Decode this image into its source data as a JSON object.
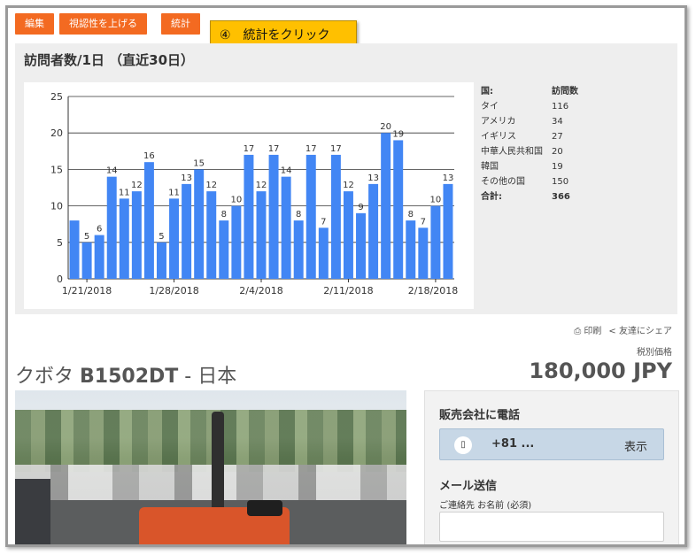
{
  "toolbar": {
    "buttons": [
      {
        "label": "編集"
      },
      {
        "label": "視認性を上げる"
      },
      {
        "label": "統計"
      }
    ]
  },
  "callout": {
    "text": "④　統計をクリック"
  },
  "stats": {
    "title": "訪問者数/1日 （直近30日）",
    "table": {
      "header": {
        "country": "国:",
        "visits": "訪問数"
      },
      "rows": [
        {
          "country": "タイ",
          "visits": "116"
        },
        {
          "country": "アメリカ",
          "visits": "34"
        },
        {
          "country": "イギリス",
          "visits": "27"
        },
        {
          "country": "中華人民共和国",
          "visits": "20"
        },
        {
          "country": "韓国",
          "visits": "19"
        },
        {
          "country": "その他の国",
          "visits": "150"
        }
      ],
      "total": {
        "label": "合計:",
        "value": "366"
      }
    }
  },
  "chart_data": {
    "type": "bar",
    "categories": [
      "1/20/2018",
      "1/21/2018",
      "1/22/2018",
      "1/23/2018",
      "1/24/2018",
      "1/25/2018",
      "1/26/2018",
      "1/27/2018",
      "1/28/2018",
      "1/29/2018",
      "1/30/2018",
      "1/31/2018",
      "2/1/2018",
      "2/2/2018",
      "2/3/2018",
      "2/4/2018",
      "2/5/2018",
      "2/6/2018",
      "2/7/2018",
      "2/8/2018",
      "2/9/2018",
      "2/10/2018",
      "2/11/2018",
      "2/12/2018",
      "2/13/2018",
      "2/14/2018",
      "2/15/2018",
      "2/16/2018",
      "2/17/2018",
      "2/18/2018"
    ],
    "values": [
      8,
      5,
      6,
      14,
      11,
      12,
      16,
      5,
      11,
      13,
      15,
      12,
      8,
      10,
      17,
      12,
      17,
      14,
      8,
      17,
      7,
      17,
      12,
      9,
      13,
      20,
      19,
      8,
      7,
      10,
      13
    ],
    "labeled": [
      false,
      true,
      true,
      true,
      true,
      true,
      true,
      true,
      true,
      true,
      true,
      true,
      true,
      true,
      true,
      true,
      true,
      true,
      true,
      true,
      true,
      true,
      true,
      true,
      true,
      true,
      true,
      true,
      true,
      true,
      true
    ],
    "x_tick_labels": [
      "1/21/2018",
      "1/28/2018",
      "2/4/2018",
      "2/11/2018",
      "2/18/2018"
    ],
    "x_tick_dates": [
      "1/21/2018",
      "1/28/2018",
      "2/4/2018",
      "2/11/2018",
      "2/18/2018"
    ],
    "y_ticks": [
      0,
      5,
      10,
      15,
      20,
      25
    ],
    "ylim": [
      0,
      25
    ],
    "grid": true,
    "bar_color": "#4286f4",
    "title": "",
    "xlabel": "",
    "ylabel": ""
  },
  "share": {
    "print": "印刷",
    "share": "友達にシェア"
  },
  "listing": {
    "tax_label": "税別価格",
    "title_prefix": "クボタ ",
    "title_model": "B1502DT",
    "title_suffix": " - 日本",
    "price": "180,000 JPY"
  },
  "seller": {
    "call_heading": "販売会社に電話",
    "phone": "+81 ...",
    "show": "表示",
    "mail_heading": "メール送信",
    "name_label": "ご連絡先 お名前 (必須)",
    "name_value": ""
  },
  "colors": {
    "button": "#f36a21",
    "callout": "#ffc000",
    "bar": "#4286f4",
    "phone_button": "#c7d7e6"
  }
}
